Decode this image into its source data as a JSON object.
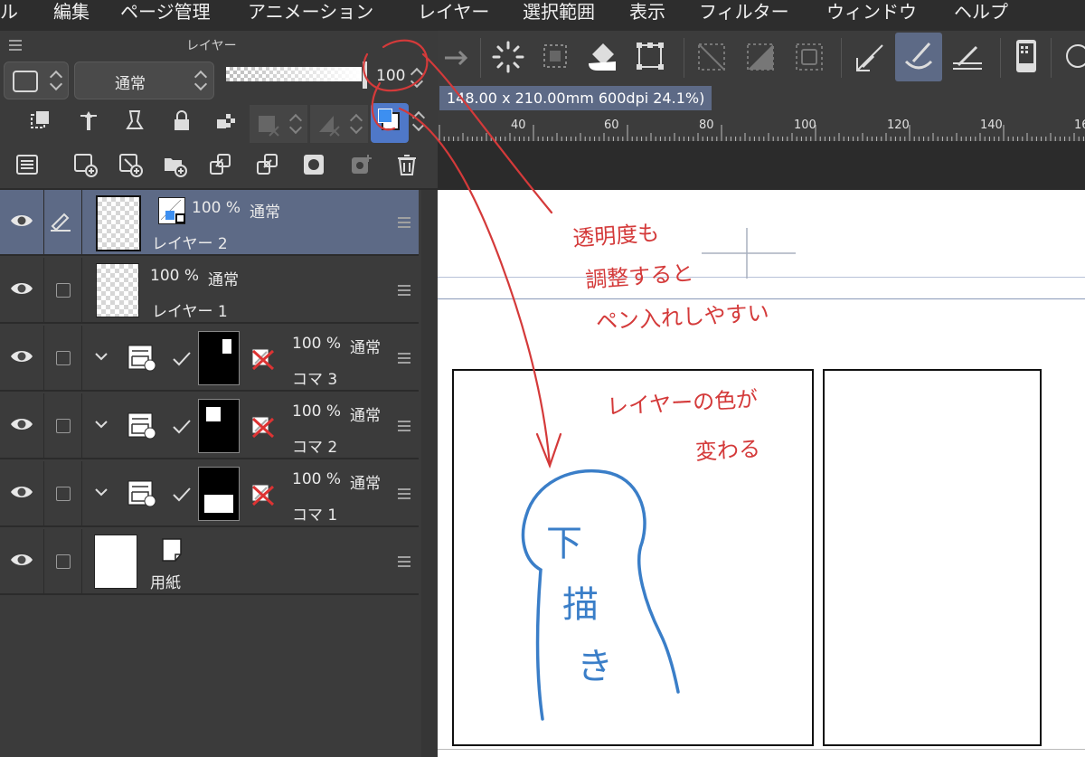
{
  "menu": [
    "ル",
    "編集",
    "ページ管理",
    "アニメーション",
    "レイヤー",
    "選択範囲",
    "表示",
    "フィルター",
    "ウィンドウ",
    "ヘルプ"
  ],
  "panel": {
    "title": "レイヤー",
    "blend_mode": "通常",
    "opacity": "100"
  },
  "canvas_info": "148.00 x 210.00mm 600dpi 24.1%)",
  "ruler_labels": [
    "40",
    "60",
    "80",
    "100",
    "120",
    "140",
    "16"
  ],
  "layers": [
    {
      "name": "レイヤー 2",
      "opacity": "100 %",
      "mode": "通常"
    },
    {
      "name": "レイヤー 1",
      "opacity": "100 %",
      "mode": "通常"
    },
    {
      "name": "コマ 3",
      "opacity": "100 %",
      "mode": "通常"
    },
    {
      "name": "コマ 2",
      "opacity": "100 %",
      "mode": "通常"
    },
    {
      "name": "コマ 1",
      "opacity": "100 %",
      "mode": "通常"
    },
    {
      "name": "用紙",
      "opacity": "",
      "mode": ""
    }
  ],
  "annotations": {
    "note1_line1": "透明度も",
    "note1_line2": "調整すると",
    "note1_line3": "ペン入れしやすい",
    "note2_line1": "レイヤーの色が",
    "note2_line2": "変わる",
    "sketch_text": [
      "下",
      "描",
      "き"
    ]
  },
  "colors": {
    "selected_row": "#5d6a86",
    "annotation_red": "#d43a3a",
    "sketch_blue": "#3a7ec8"
  }
}
